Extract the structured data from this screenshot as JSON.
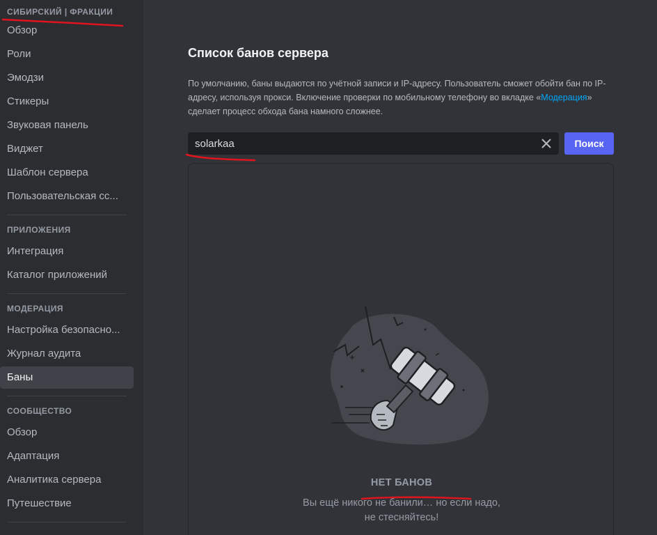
{
  "sidebar": {
    "server_header": "СИБИРСКИЙ | ФРАКЦИИ",
    "sections": [
      {
        "header": "",
        "items": [
          "Обзор",
          "Роли",
          "Эмодзи",
          "Стикеры",
          "Звуковая панель",
          "Виджет",
          "Шаблон сервера",
          "Пользовательская сс..."
        ]
      },
      {
        "header": "ПРИЛОЖЕНИЯ",
        "items": [
          "Интеграция",
          "Каталог приложений"
        ]
      },
      {
        "header": "МОДЕРАЦИЯ",
        "items": [
          "Настройка безопасно...",
          "Журнал аудита",
          "Баны"
        ]
      },
      {
        "header": "СООБЩЕСТВО",
        "items": [
          "Обзор",
          "Адаптация",
          "Аналитика сервера",
          "Путешествие"
        ]
      }
    ],
    "selected": "Баны"
  },
  "main": {
    "title": "Список банов сервера",
    "description_part1": "По умолчанию, баны выдаются по учётной записи и IP-адресу. Пользователь сможет обойти бан по IP-адресу, используя прокси. Включение проверки по мобильному телефону во вкладке «",
    "description_link": "Модерация",
    "description_part2": "» сделает процесс обхода бана намного сложнее.",
    "search": {
      "value": "solarkaa"
    },
    "search_button": "Поиск",
    "empty_title": "НЕТ БАНОВ",
    "empty_subtitle": "Вы ещё никого не банили… но если надо, не стесняйтесь!"
  },
  "colors": {
    "background": "#313338",
    "sidebar": "#2b2d31",
    "accent": "#5865f2",
    "link": "#00a8fc",
    "annotation": "#e0141e"
  },
  "icons": {
    "clear": "close-icon",
    "illustration": "ban-hammer-illustration"
  }
}
